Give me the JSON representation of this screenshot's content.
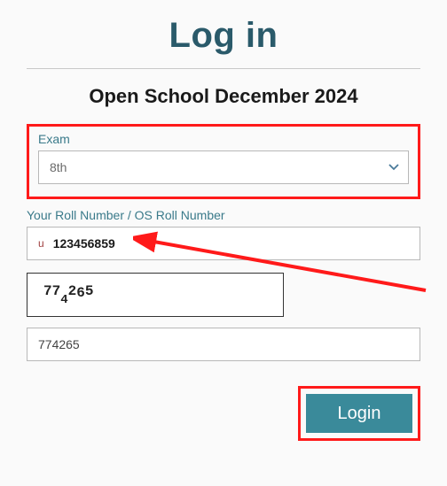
{
  "title": "Log in",
  "subtitle": "Open School December 2024",
  "exam": {
    "label": "Exam",
    "value": "8th"
  },
  "roll": {
    "label": "Your Roll Number / OS Roll Number",
    "prefix": "u",
    "value": "123456859"
  },
  "captcha": {
    "digits": [
      "7",
      "7",
      "4",
      "2",
      "6",
      "5"
    ]
  },
  "captcha_input": {
    "value": "774265"
  },
  "button": {
    "login": "Login"
  },
  "annotation": {
    "boxColor": "#ff1a1a"
  }
}
